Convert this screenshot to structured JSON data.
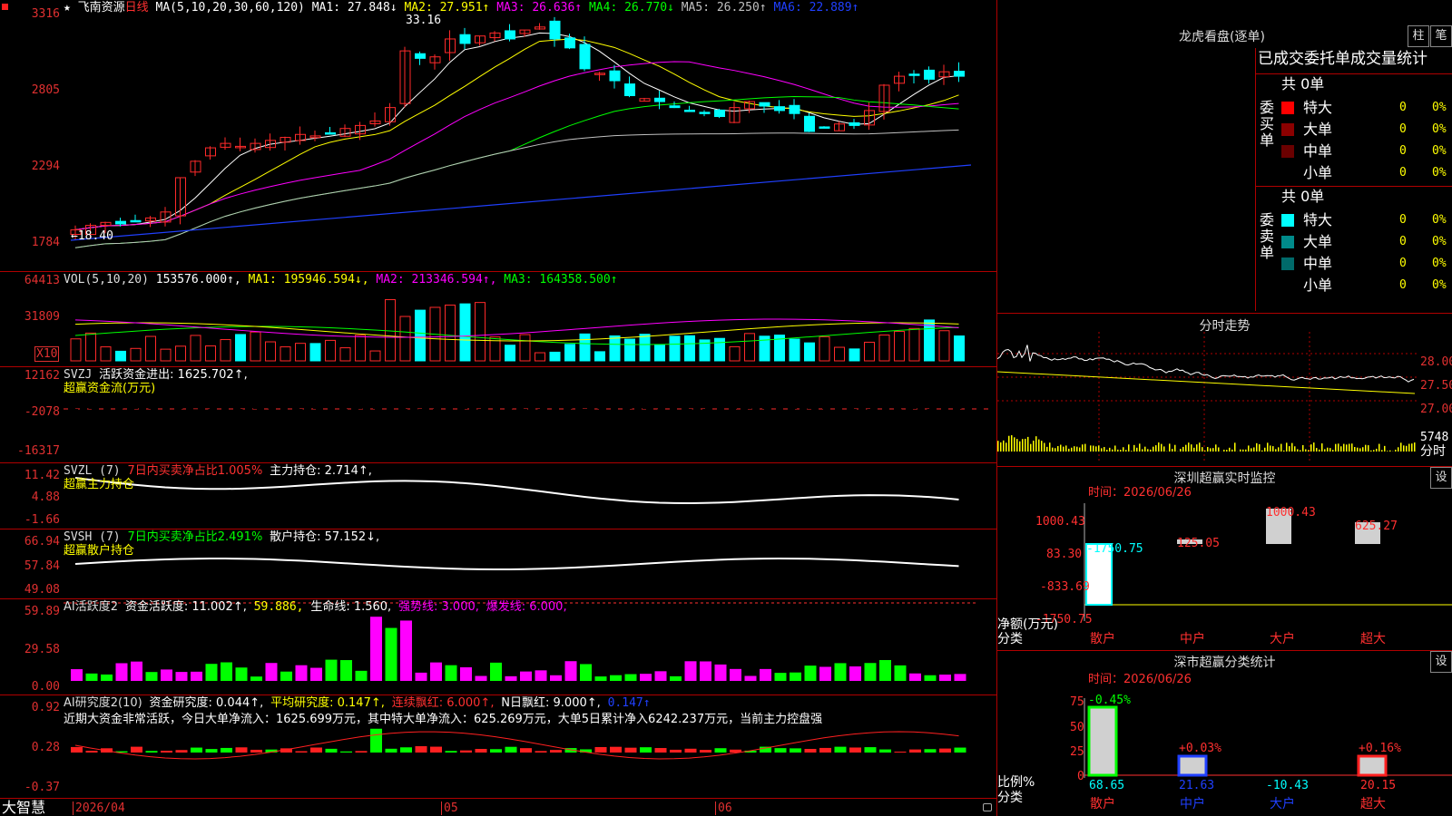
{
  "header": {
    "star": "★",
    "stock_name": "飞南资源",
    "period": "日线",
    "ma_params": "MA(5,10,20,30,60,120)",
    "ma1": "MA1: 27.848↓",
    "ma2": "MA2: 27.951↑",
    "ma3": "MA3: 26.636↑",
    "ma4": "MA4: 26.770↓",
    "ma5": "MA5: 26.250↑",
    "ma6": "MA6: 22.889↑"
  },
  "colors": {
    "up": "#ff2a2a",
    "down": "#00ffff",
    "grid": "#b00000",
    "ma1": "#ffffff",
    "ma2": "#ffff00",
    "ma3": "#ff00ff",
    "ma4": "#00ff00",
    "ma5": "#c0c0c0",
    "ma6": "#2040ff"
  },
  "price_panel": {
    "yticks": [
      "3316",
      "2805",
      "2294",
      "1784"
    ],
    "high_mark": "33.16",
    "low_mark": "←18.40"
  },
  "volume_panel": {
    "title": "VOL(5,10,20)",
    "value": "153576.000↑,",
    "ma1": "MA1: 195946.594↓,",
    "ma2": "MA2: 213346.594↑,",
    "ma3": "MA3: 164358.500↑",
    "yticks": [
      "64413",
      "31809"
    ],
    "multiplier": "X10"
  },
  "svzj_panel": {
    "title": "SVZJ",
    "desc": "活跃资金进出: 1625.702↑,",
    "subtitle": "超赢资金流(万元)",
    "yticks": [
      "12162",
      "-2078",
      "-16317"
    ]
  },
  "svzl_panel": {
    "title": "SVZL (7)",
    "desc1": "7日内买卖净占比1.005%",
    "desc2": "主力持仓: 2.714↑,",
    "subtitle": "超赢主力持仓",
    "yticks": [
      "11.42",
      "4.88",
      "-1.66"
    ]
  },
  "svsh_panel": {
    "title": "SVSH (7)",
    "desc1": "7日内买卖净占比2.491%",
    "desc2": "散户持仓: 57.152↓,",
    "subtitle": "超赢散户持仓",
    "yticks": [
      "66.94",
      "57.84",
      "49.08"
    ]
  },
  "ai2_panel": {
    "title": "AI活跃度2",
    "desc1": "资金活跃度: 11.002↑,",
    "desc2": "59.886,",
    "desc3": "生命线: 1.560,",
    "desc4": "强势线: 3.000,",
    "desc5": "爆发线: 6.000,",
    "yticks": [
      "59.89",
      "29.58",
      "0.00"
    ]
  },
  "ai_research_panel": {
    "title": "AI研究度2(10)",
    "desc1": "资金研究度: 0.044↑,",
    "desc2": "平均研究度: 0.147↑,",
    "desc3": "连续飘红: 6.000↑,",
    "desc4": "N日飘红: 9.000↑,",
    "desc5": "0.147↑",
    "comment": "近期大资金非常活跃，今日大单净流入：1625.699万元，其中特大单净流入：625.269万元，大单5日累计净入6242.237万元，当前主力控盘强",
    "yticks": [
      "0.92",
      "0.28",
      "-0.37"
    ]
  },
  "bottom_axis": {
    "brand": "大智慧",
    "date_start": "2026/04",
    "m05": "05",
    "m06": "06"
  },
  "right_panel": {
    "lhb_title": "龙虎看盘(逐单)",
    "btn_zhu": "柱",
    "btn_bi": "笔",
    "tab_header": "已成交委托单成交量统计",
    "buy_label": "委买单",
    "sell_label": "委卖单",
    "buy_total": "共 0单",
    "sell_total": "共 0单",
    "buy_rows": [
      {
        "name": "特大",
        "count": "0",
        "pct": "0%"
      },
      {
        "name": "大单",
        "count": "0",
        "pct": "0%"
      },
      {
        "name": "中单",
        "count": "0",
        "pct": "0%"
      },
      {
        "name": "小单",
        "count": "0",
        "pct": "0%"
      }
    ],
    "sell_rows": [
      {
        "name": "特大",
        "count": "0",
        "pct": "0%"
      },
      {
        "name": "大单",
        "count": "0",
        "pct": "0%"
      },
      {
        "name": "中单",
        "count": "0",
        "pct": "0%"
      },
      {
        "name": "小单",
        "count": "0",
        "pct": "0%"
      }
    ],
    "buy_colors": [
      "#ff0000",
      "#8b0000",
      "#6a0000",
      "#000000"
    ],
    "sell_colors": [
      "#00ffff",
      "#008b8b",
      "#006a6a",
      "#000000"
    ],
    "fenshi_title": "分时走势",
    "fenshi_yticks": [
      "28.00",
      "27.50",
      "27.00"
    ],
    "fenshi_vol": "5748",
    "fenshi_label": "分时",
    "monitor_title": "深圳超赢实时监控",
    "monitor_btn": "设",
    "monitor_time": "时间：2026/06/26",
    "monitor_yticks": [
      "1000.43",
      "83.30",
      "-833.69",
      "-1750.75"
    ],
    "monitor_axis_label": "净额(万元)",
    "monitor_cat_label": "分类",
    "monitor_values": [
      "-1750.75",
      "125.05",
      "1000.43",
      "625.27"
    ],
    "monitor_cats": [
      "散户",
      "中户",
      "大户",
      "超大"
    ],
    "stats_title": "深市超赢分类统计",
    "stats_btn": "设",
    "stats_time": "时间：2026/06/26",
    "stats_yticks": [
      "75",
      "50",
      "25",
      "0"
    ],
    "stats_top_labels": [
      "-0.45%",
      "+0.03%",
      "",
      "+0.16%"
    ],
    "stats_axis_label": "比例%",
    "stats_cat_label": "分类",
    "stats_values": [
      "68.65",
      "21.63",
      "-10.43",
      "20.15"
    ],
    "stats_cats": [
      "散户",
      "中户",
      "大户",
      "超大"
    ]
  }
}
